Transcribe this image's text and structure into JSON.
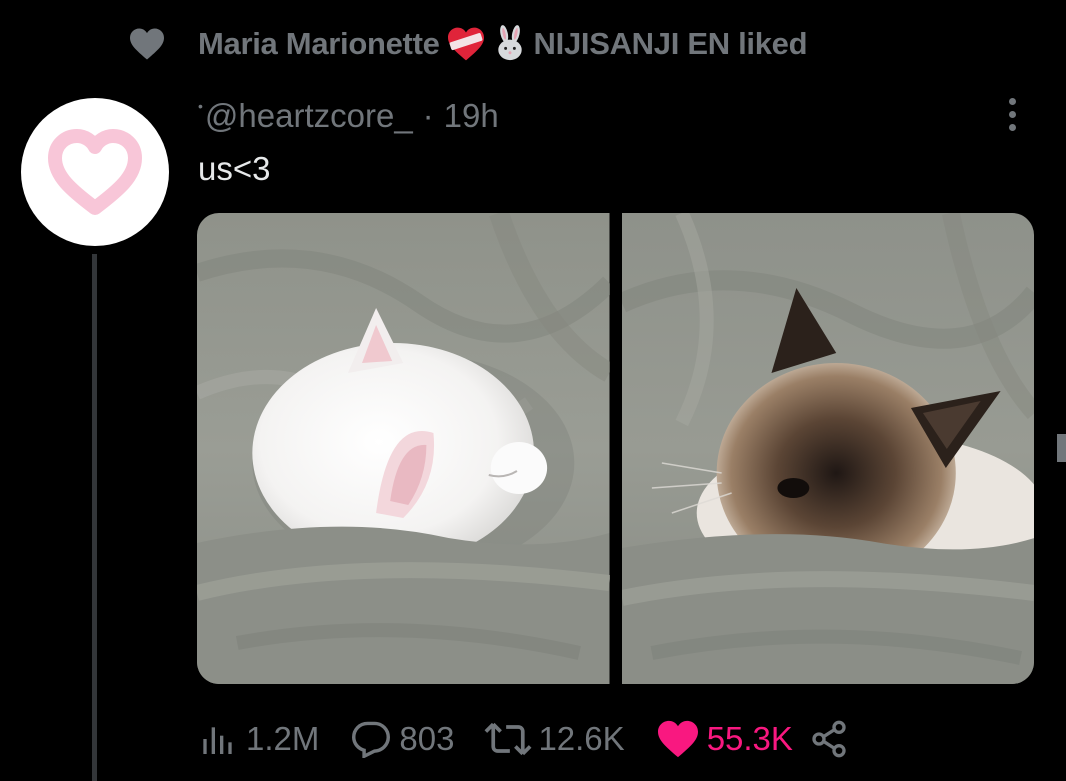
{
  "social_context": {
    "icon": "heart-icon",
    "user_name": "Maria Marionette",
    "emoji_1": "bandaged-heart",
    "emoji_2": "rabbit",
    "text": "NIJISANJI EN liked"
  },
  "tweet": {
    "avatar_icon": "pink-heart-avatar",
    "handle": "@heartzcore_",
    "separator": "·",
    "time": "19h",
    "text": "us<3",
    "media": [
      {
        "alt": "white cat sleeping under grey blanket"
      },
      {
        "alt": "ragdoll cat sleeping under grey blanket"
      }
    ]
  },
  "actions": {
    "views": "1.2M",
    "replies": "803",
    "retweets": "12.6K",
    "likes": "55.3K"
  },
  "colors": {
    "background": "#000000",
    "muted": "#71767b",
    "text": "#e7e9ea",
    "like": "#f91880",
    "avatar_heart": "#f8c6d8"
  }
}
